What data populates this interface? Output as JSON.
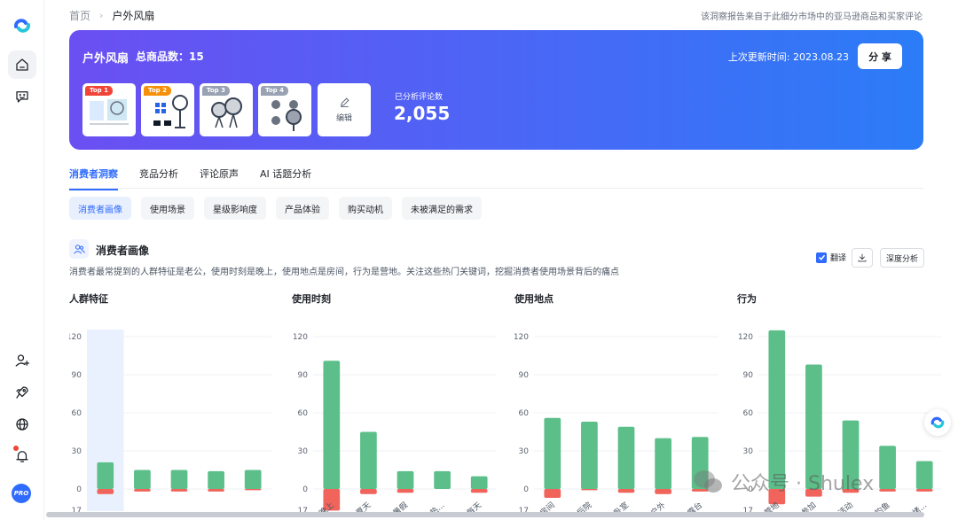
{
  "breadcrumb": {
    "home": "首页",
    "current": "户外风扇"
  },
  "source_note": "该洞察报告来自于此细分市场中的亚马逊商品和买家评论",
  "banner": {
    "title": "户外风扇",
    "product_count": "总商品数：15",
    "updated": "上次更新时间: 2023.08.23",
    "share": "分 享",
    "edit": "编辑",
    "reviews_label": "已分析评论数",
    "reviews_value": "2,055",
    "thumbnails": [
      {
        "tag": "Top 1",
        "color": "#f04438"
      },
      {
        "tag": "Top 2",
        "color": "#f79009"
      },
      {
        "tag": "Top 3",
        "color": "#98a2b3"
      },
      {
        "tag": "Top 4",
        "color": "#98a2b3"
      }
    ]
  },
  "tabs": [
    "消费者洞察",
    "竞品分析",
    "评论原声",
    "AI 话题分析"
  ],
  "subtabs": [
    "消费者画像",
    "使用场景",
    "星级影响度",
    "产品体验",
    "购买动机",
    "未被满足的需求"
  ],
  "section": {
    "title": "消费者画像",
    "description": "消费者最常提到的人群特征是老公，使用时刻是晚上，使用地点是房间，行为是营地。关注这些热门关键词，挖掘消费者使用场景背后的痛点",
    "translate": "翻译",
    "deep_analysis": "深度分析"
  },
  "colors": {
    "positive": "#5cbf8a",
    "negative": "#f0645c",
    "accent": "#2f6bff"
  },
  "watermark": "公众号 · Shulex",
  "chart_data": [
    {
      "type": "bar",
      "title": "人群特征",
      "yticks": [
        120,
        90,
        60,
        30,
        0,
        17
      ],
      "categories": [
        "",
        "",
        "",
        "",
        ""
      ],
      "series": [
        {
          "values": [
            21,
            15,
            15,
            14,
            15
          ]
        },
        {
          "values": [
            -4,
            -2,
            -2,
            -2,
            -1
          ]
        }
      ],
      "highlight_index": 0
    },
    {
      "type": "bar",
      "title": "使用时刻",
      "yticks": [
        120,
        90,
        60,
        30,
        0,
        17
      ],
      "categories": [
        "晚上",
        "夏天",
        "暑假",
        "炎热...",
        "每天"
      ],
      "series": [
        {
          "values": [
            101,
            45,
            14,
            14,
            10
          ]
        },
        {
          "values": [
            -17,
            -4,
            -3,
            0,
            -3
          ]
        }
      ]
    },
    {
      "type": "bar",
      "title": "使用地点",
      "yticks": [
        120,
        90,
        60,
        30,
        0,
        17
      ],
      "categories": [
        "房间",
        "后院",
        "卧室",
        "户外",
        "露台"
      ],
      "series": [
        {
          "values": [
            56,
            53,
            49,
            40,
            41
          ]
        },
        {
          "values": [
            -7,
            -1,
            -3,
            -4,
            -2
          ]
        }
      ]
    },
    {
      "type": "bar",
      "title": "行为",
      "yticks": [
        120,
        90,
        60,
        30,
        0,
        17
      ],
      "categories": [
        "营地",
        "参加",
        "活动",
        "钓鱼",
        "烧烤..."
      ],
      "series": [
        {
          "values": [
            125,
            98,
            54,
            34,
            22
          ]
        },
        {
          "values": [
            -12,
            -6,
            -3,
            -2,
            -2
          ]
        }
      ]
    }
  ]
}
